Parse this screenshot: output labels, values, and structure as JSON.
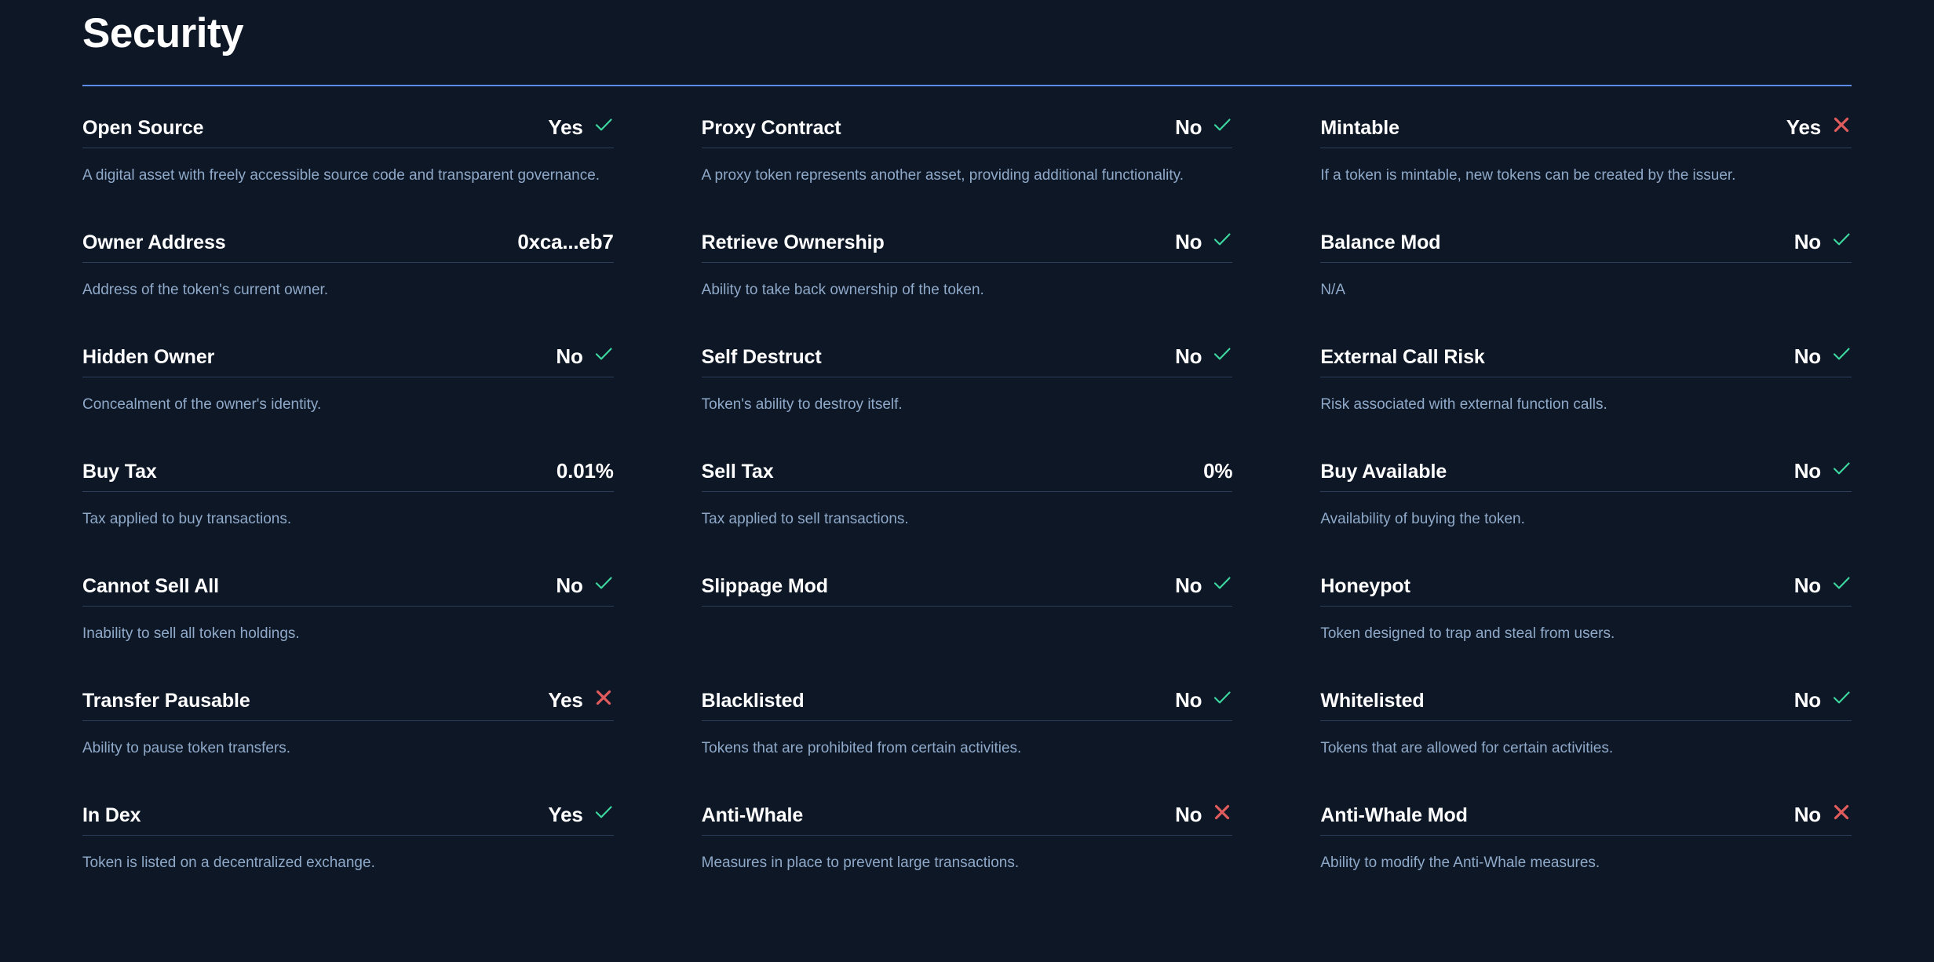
{
  "header": {
    "title": "Security"
  },
  "colors": {
    "background": "#0e1726",
    "accent_rule": "#5b8def",
    "divider": "#2c3e5a",
    "label": "#ffffff",
    "description": "#8fa9c9",
    "check_icon": "#3dd9a0",
    "cross_icon": "#e05c5c"
  },
  "columns": [
    {
      "items": [
        {
          "label": "Open Source",
          "value": "Yes",
          "icon": "check-icon",
          "description": "A digital asset with freely accessible source code and transparent governance.",
          "divider_after_label": true
        },
        {
          "label": "Owner Address",
          "value": "0xca...eb7",
          "icon": "none",
          "description": "Address of the token's current owner.",
          "divider_after_label": true
        },
        {
          "label": "Hidden Owner",
          "value": "No",
          "icon": "check-icon",
          "description": "Concealment of the owner's identity.",
          "divider_after_label": true
        },
        {
          "label": "Buy Tax",
          "value": "0.01%",
          "icon": "none",
          "description": "Tax applied to buy transactions.",
          "divider_after_label": true
        },
        {
          "label": "Cannot Sell All",
          "value": "No",
          "icon": "check-icon",
          "description": "Inability to sell all token holdings.",
          "divider_after_label": true
        },
        {
          "label": "Transfer Pausable",
          "value": "Yes",
          "icon": "cross-icon",
          "description": "Ability to pause token transfers.",
          "divider_after_label": true
        },
        {
          "label": "In Dex",
          "value": "Yes",
          "icon": "check-icon",
          "description": "Token is listed on a decentralized exchange.",
          "divider_after_label": true
        }
      ]
    },
    {
      "items": [
        {
          "label": "Proxy Contract",
          "value": "No",
          "icon": "check-icon",
          "description": "A proxy token represents another asset, providing additional functionality.",
          "divider_after_label": true
        },
        {
          "label": "Retrieve Ownership",
          "value": "No",
          "icon": "check-icon",
          "description": "Ability to take back ownership of the token.",
          "divider_after_label": true
        },
        {
          "label": "Self Destruct",
          "value": "No",
          "icon": "check-icon",
          "description": "Token's ability to destroy itself.",
          "divider_after_label": true
        },
        {
          "label": "Sell Tax",
          "value": "0%",
          "icon": "none",
          "description": "Tax applied to sell transactions.",
          "divider_after_label": true
        },
        {
          "label": "Slippage Mod",
          "value": "No",
          "icon": "check-icon",
          "description": "",
          "divider_after_label": true
        },
        {
          "label": "Blacklisted",
          "value": "No",
          "icon": "check-icon",
          "description": "Tokens that are prohibited from certain activities.",
          "divider_after_label": true
        },
        {
          "label": "Anti-Whale",
          "value": "No",
          "icon": "cross-icon",
          "description": "Measures in place to prevent large transactions.",
          "divider_after_label": true
        }
      ]
    },
    {
      "items": [
        {
          "label": "Mintable",
          "value": "Yes",
          "icon": "cross-icon",
          "description": "If a token is mintable, new tokens can be created by the issuer.",
          "divider_after_label": true
        },
        {
          "label": "Balance Mod",
          "value": "No",
          "icon": "check-icon",
          "description": "N/A",
          "divider_after_label": true
        },
        {
          "label": "External Call Risk",
          "value": "No",
          "icon": "check-icon",
          "description": "Risk associated with external function calls.",
          "divider_after_label": true
        },
        {
          "label": "Buy Available",
          "value": "No",
          "icon": "check-icon",
          "description": "Availability of buying the token.",
          "divider_after_label": true
        },
        {
          "label": "Honeypot",
          "value": "No",
          "icon": "check-icon",
          "description": "Token designed to trap and steal from users.",
          "divider_after_label": true
        },
        {
          "label": "Whitelisted",
          "value": "No",
          "icon": "check-icon",
          "description": "Tokens that are allowed for certain activities.",
          "divider_after_label": true
        },
        {
          "label": "Anti-Whale Mod",
          "value": "No",
          "icon": "cross-icon",
          "description": "Ability to modify the Anti-Whale measures.",
          "divider_after_label": true
        }
      ]
    }
  ]
}
